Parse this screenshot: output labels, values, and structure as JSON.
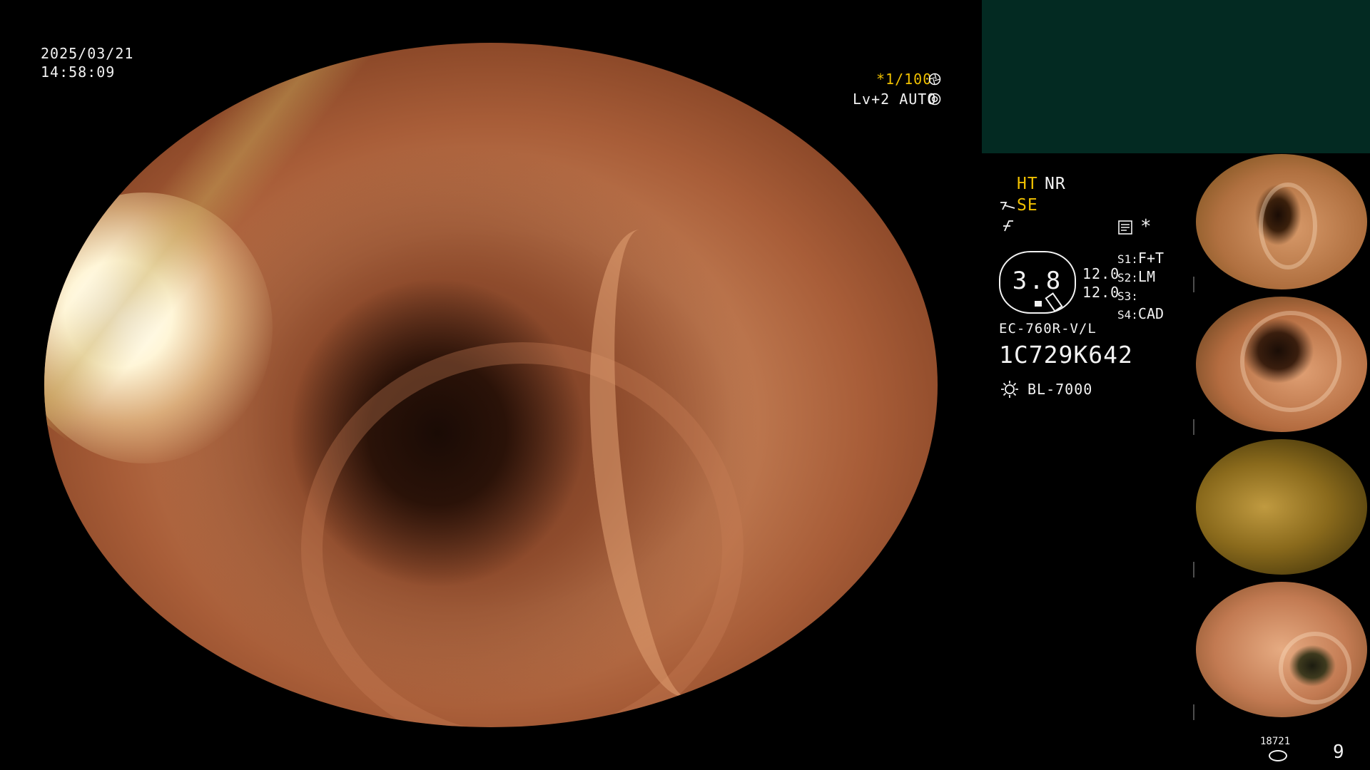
{
  "datetime": {
    "date": "2025/03/21",
    "time": "14:58:09"
  },
  "shutter": {
    "speed": "*1/100",
    "level": "Lv+2 AUTO"
  },
  "modes": {
    "ht": "HT",
    "nr": "NR",
    "se": "SE"
  },
  "zoom": {
    "value": "3.8",
    "mark_a": "12.0",
    "mark_b": "12.0"
  },
  "switches": {
    "s1_key": "S1:",
    "s1_val": "F+T",
    "s2_key": "S2:",
    "s2_val": "LM",
    "s3_key": "S3:",
    "s3_val": "",
    "s4_key": "S4:",
    "s4_val": "CAD"
  },
  "scope": {
    "model": "EC-760R-V/L",
    "serial": "1C729K642"
  },
  "light_source": {
    "model": "BL-7000"
  },
  "storage": {
    "count": "18721",
    "captures": "9"
  },
  "colors": {
    "overlay_yellow": "#f0c000",
    "panel_green": "#032a22"
  },
  "icons": {
    "shutter": "aperture-icon",
    "auto": "iris-icon",
    "se": "structure-enhancement-icon",
    "color": "color-mode-icon",
    "record": "record-icon",
    "lamp": "light-source-icon",
    "disk": "storage-disk-icon"
  }
}
